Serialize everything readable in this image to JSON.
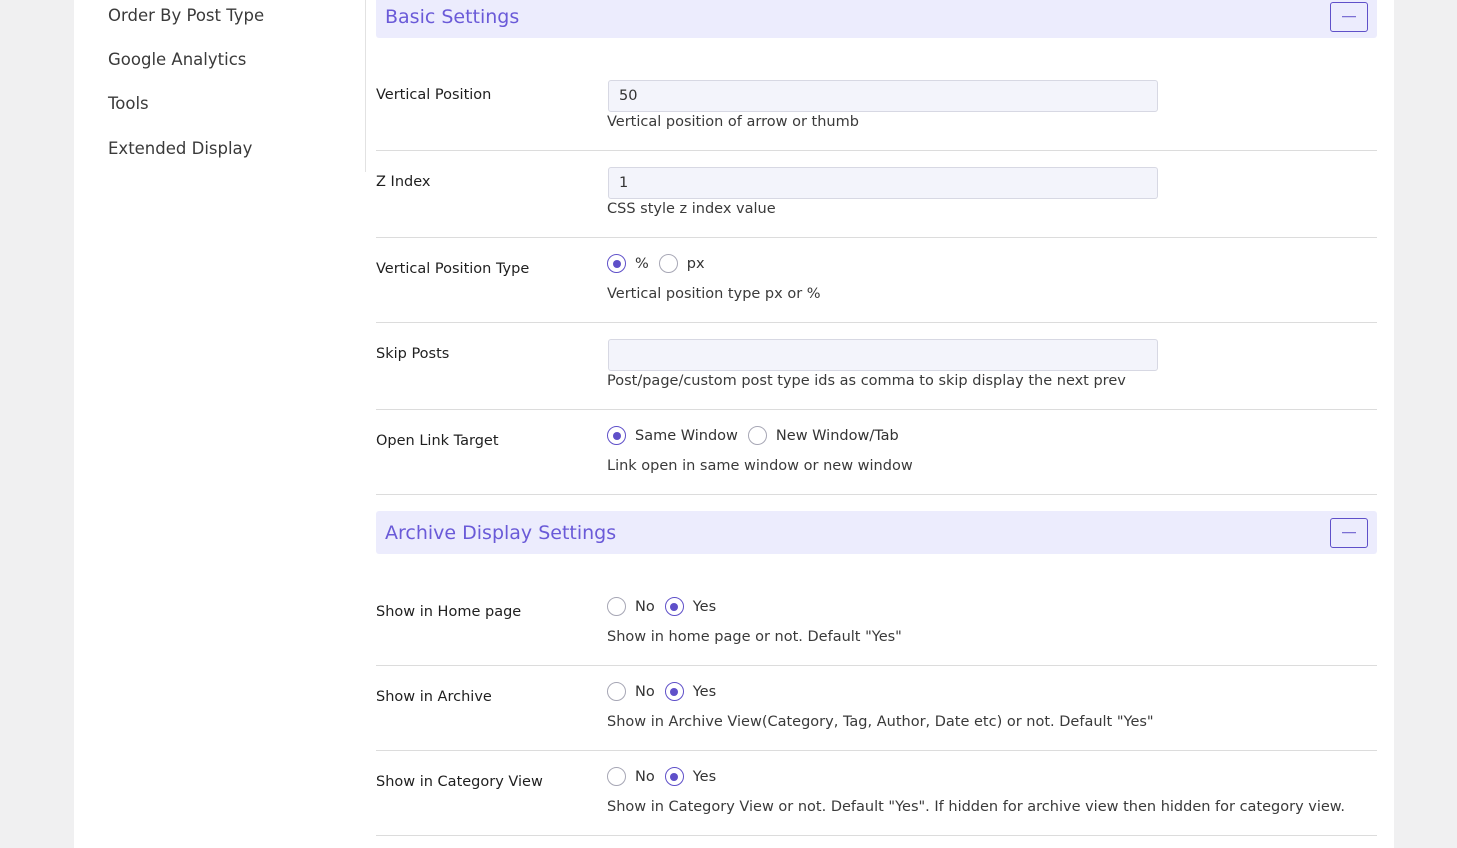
{
  "sidebar": {
    "items": [
      {
        "label": "Order By Post Type"
      },
      {
        "label": "Google Analytics"
      },
      {
        "label": "Tools"
      },
      {
        "label": "Extended Display"
      }
    ]
  },
  "sections": {
    "basic": {
      "title": "Basic Settings",
      "rows": {
        "vertical_position": {
          "label": "Vertical Position",
          "value": "50",
          "help": "Vertical position of arrow or thumb"
        },
        "z_index": {
          "label": "Z Index",
          "value": "1",
          "help": "CSS style z index value"
        },
        "vertical_position_type": {
          "label": "Vertical Position Type",
          "options": [
            "%",
            "px"
          ],
          "selected": "%",
          "help": "Vertical position type px or %"
        },
        "skip_posts": {
          "label": "Skip Posts",
          "value": "",
          "help": "Post/page/custom post type ids as comma to skip display the next prev"
        },
        "open_link_target": {
          "label": "Open Link Target",
          "options": [
            "Same Window",
            "New Window/Tab"
          ],
          "selected": "Same Window",
          "help": "Link open in same window or new window"
        }
      }
    },
    "archive": {
      "title": "Archive Display Settings",
      "rows": {
        "show_home": {
          "label": "Show in Home page",
          "options": [
            "No",
            "Yes"
          ],
          "selected": "Yes",
          "help": "Show in home page or not. Default \"Yes\""
        },
        "show_archive": {
          "label": "Show in Archive",
          "options": [
            "No",
            "Yes"
          ],
          "selected": "Yes",
          "help": "Show in Archive View(Category, Tag, Author, Date etc) or not. Default \"Yes\""
        },
        "show_category": {
          "label": "Show in Category View",
          "options": [
            "No",
            "Yes"
          ],
          "selected": "Yes",
          "help": "Show in Category View or not. Default \"Yes\". If hidden for archive view then hidden for category view."
        }
      }
    }
  },
  "colors": {
    "accent": "#5f50c9",
    "section_title": "#6a5ad8",
    "section_bg": "#ececfd",
    "page_bg": "#f0f0f1",
    "input_bg": "#f3f4fb"
  }
}
